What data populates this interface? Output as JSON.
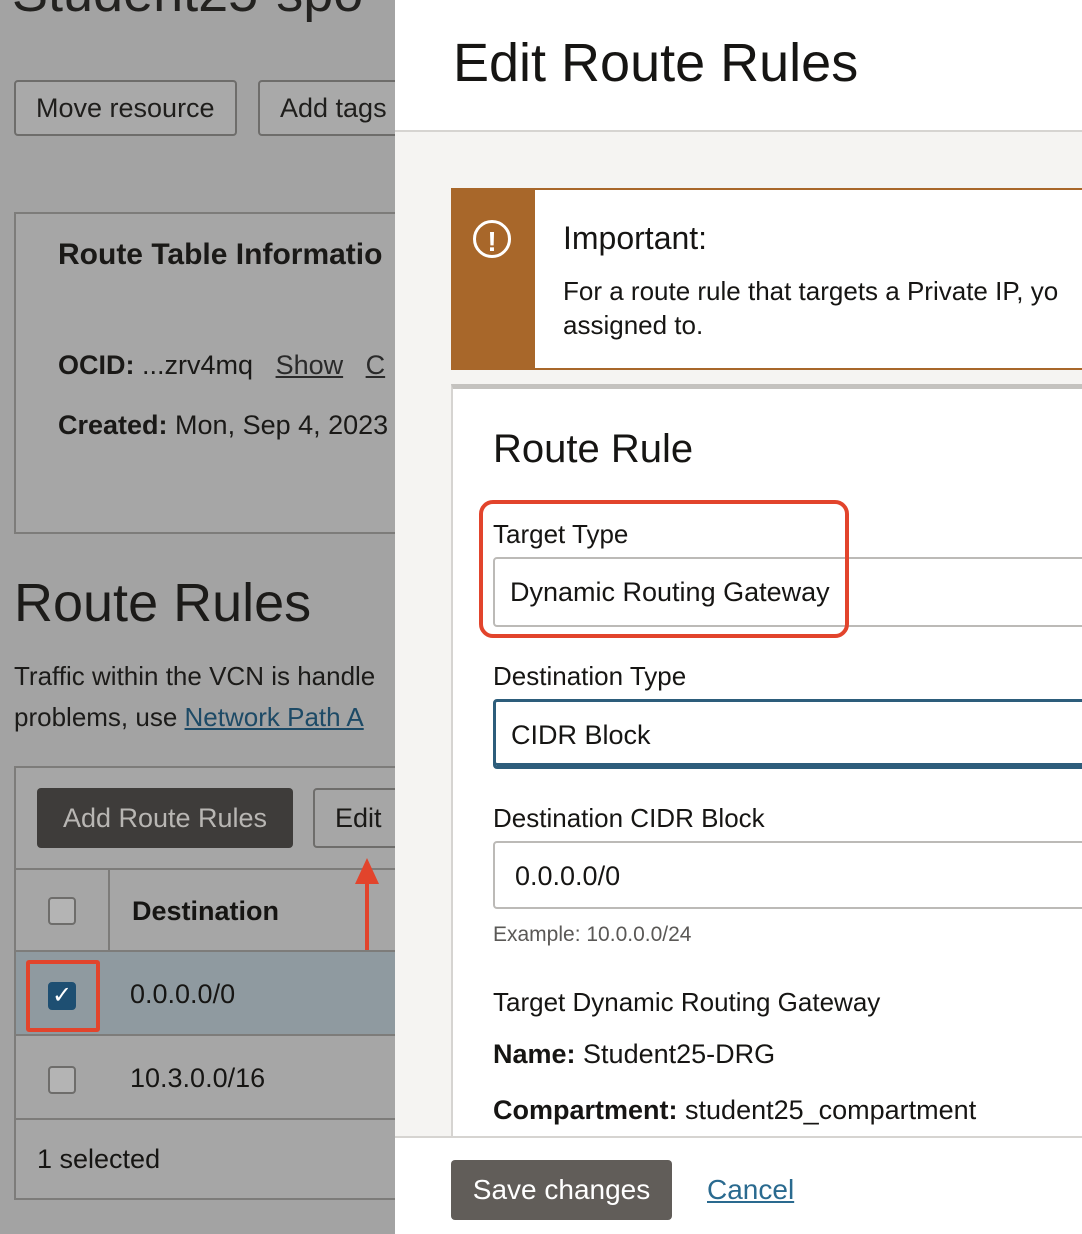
{
  "background_page": {
    "title": "Student25-spo",
    "move_resource_label": "Move resource",
    "add_tags_label": "Add tags",
    "info": {
      "heading": "Route Table Informatio",
      "ocid_label": "OCID:",
      "ocid_value": "...zrv4mq",
      "show_label": "Show",
      "copy_label": "C",
      "created_label": "Created:",
      "created_value": "Mon, Sep 4, 2023"
    },
    "route_rules": {
      "title": "Route Rules",
      "desc_line1": "Traffic within the VCN is handle",
      "desc_line2_prefix": "problems, use ",
      "desc_link": "Network Path A",
      "add_button_label": "Add Route Rules",
      "edit_button_label": "Edit",
      "column_destination": "Destination",
      "rows": [
        {
          "destination": "0.0.0.0/0",
          "checked": true
        },
        {
          "destination": "10.3.0.0/16",
          "checked": false
        }
      ],
      "selected_count_label": "1 selected"
    }
  },
  "drawer": {
    "title": "Edit Route Rules",
    "notice": {
      "title": "Important:",
      "line1": "For a route rule that targets a Private IP, yo",
      "line2": "assigned to."
    },
    "rule": {
      "title": "Route Rule",
      "target_type_label": "Target Type",
      "target_type_value": "Dynamic Routing Gateway",
      "destination_type_label": "Destination Type",
      "destination_type_value": "CIDR Block",
      "destination_cidr_label": "Destination CIDR Block",
      "destination_cidr_value": "0.0.0.0/0",
      "destination_cidr_hint": "Example: 10.0.0.0/24",
      "target_drg_label": "Target Dynamic Routing Gateway",
      "name_label": "Name:",
      "name_value": "Student25-DRG",
      "compartment_label": "Compartment:",
      "compartment_value": "student25_compartment"
    },
    "save_label": "Save changes",
    "cancel_label": "Cancel"
  },
  "colors": {
    "accent_highlight": "#e2442c",
    "notice_bar": "#a8672a",
    "checkbox_checked": "#1e4f72",
    "primary_button": "#615d59"
  }
}
